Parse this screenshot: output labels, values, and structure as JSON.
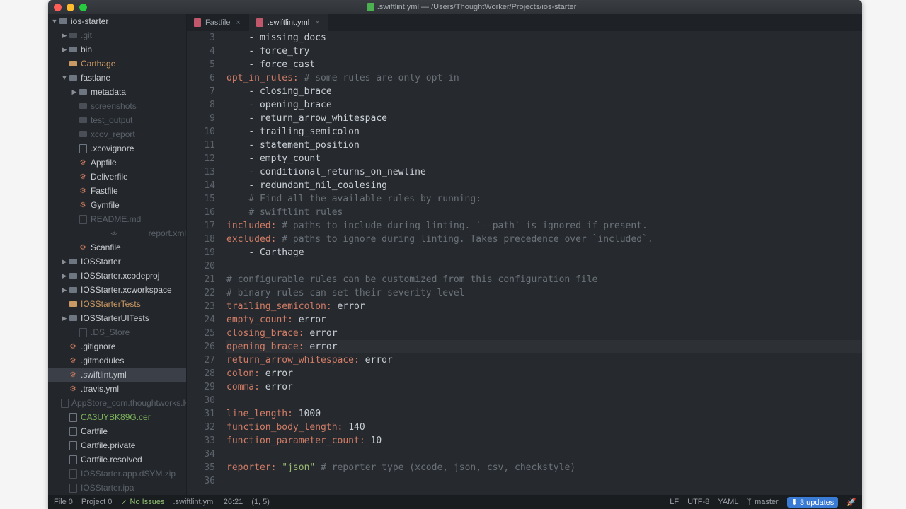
{
  "window": {
    "title": ".swiftlint.yml — /Users/ThoughtWorker/Projects/ios-starter"
  },
  "tree": [
    {
      "depth": 0,
      "chev": "▼",
      "icon": "folder",
      "label": "ios-starter"
    },
    {
      "depth": 1,
      "chev": "▶",
      "icon": "folder dim",
      "label": ".git",
      "cls": "dim"
    },
    {
      "depth": 1,
      "chev": "▶",
      "icon": "folder",
      "label": "bin"
    },
    {
      "depth": 1,
      "chev": "",
      "icon": "folder hl",
      "label": "Carthage",
      "cls": "hl"
    },
    {
      "depth": 1,
      "chev": "▼",
      "icon": "folder",
      "label": "fastlane"
    },
    {
      "depth": 2,
      "chev": "▶",
      "icon": "folder",
      "label": "metadata"
    },
    {
      "depth": 2,
      "chev": "",
      "icon": "folder dim",
      "label": "screenshots",
      "cls": "dim"
    },
    {
      "depth": 2,
      "chev": "",
      "icon": "folder dim",
      "label": "test_output",
      "cls": "dim"
    },
    {
      "depth": 2,
      "chev": "",
      "icon": "folder dim",
      "label": "xcov_report",
      "cls": "dim"
    },
    {
      "depth": 2,
      "chev": "",
      "icon": "file",
      "label": ".xcovignore"
    },
    {
      "depth": 2,
      "chev": "",
      "icon": "gear",
      "label": "Appfile"
    },
    {
      "depth": 2,
      "chev": "",
      "icon": "gear",
      "label": "Deliverfile"
    },
    {
      "depth": 2,
      "chev": "",
      "icon": "gear",
      "label": "Fastfile"
    },
    {
      "depth": 2,
      "chev": "",
      "icon": "gear",
      "label": "Gymfile"
    },
    {
      "depth": 2,
      "chev": "",
      "icon": "file dim",
      "label": "README.md",
      "cls": "dim"
    },
    {
      "depth": 2,
      "chev": "",
      "icon": "code",
      "label": "report.xml",
      "cls": "dim"
    },
    {
      "depth": 2,
      "chev": "",
      "icon": "gear",
      "label": "Scanfile"
    },
    {
      "depth": 1,
      "chev": "▶",
      "icon": "folder",
      "label": "IOSStarter"
    },
    {
      "depth": 1,
      "chev": "▶",
      "icon": "folder",
      "label": "IOSStarter.xcodeproj"
    },
    {
      "depth": 1,
      "chev": "▶",
      "icon": "folder",
      "label": "IOSStarter.xcworkspace"
    },
    {
      "depth": 1,
      "chev": "",
      "icon": "folder hl",
      "label": "IOSStarterTests",
      "cls": "hl"
    },
    {
      "depth": 1,
      "chev": "▶",
      "icon": "folder",
      "label": "IOSStarterUITests"
    },
    {
      "depth": 2,
      "chev": "",
      "icon": "file dim",
      "label": ".DS_Store",
      "cls": "dim"
    },
    {
      "depth": 1,
      "chev": "",
      "icon": "gear",
      "label": ".gitignore"
    },
    {
      "depth": 1,
      "chev": "",
      "icon": "gear",
      "label": ".gitmodules"
    },
    {
      "depth": 1,
      "chev": "",
      "icon": "gear",
      "label": ".swiftlint.yml",
      "selected": true
    },
    {
      "depth": 1,
      "chev": "",
      "icon": "gear",
      "label": ".travis.yml"
    },
    {
      "depth": 1,
      "chev": "",
      "icon": "file dim",
      "label": "AppStore_com.thoughtworks.IOSS",
      "cls": "dim"
    },
    {
      "depth": 1,
      "chev": "",
      "icon": "file",
      "label": "CA3UYBK89G.cer",
      "cls": "green"
    },
    {
      "depth": 1,
      "chev": "",
      "icon": "file",
      "label": "Cartfile"
    },
    {
      "depth": 1,
      "chev": "",
      "icon": "file",
      "label": "Cartfile.private"
    },
    {
      "depth": 1,
      "chev": "",
      "icon": "file",
      "label": "Cartfile.resolved"
    },
    {
      "depth": 1,
      "chev": "",
      "icon": "file dim",
      "label": "IOSStarter.app.dSYM.zip",
      "cls": "dim"
    },
    {
      "depth": 1,
      "chev": "",
      "icon": "file dim",
      "label": "IOSStarter.ipa",
      "cls": "dim"
    }
  ],
  "tabs": [
    {
      "label": "Fastfile",
      "active": false
    },
    {
      "label": ".swiftlint.yml",
      "active": true
    }
  ],
  "code": {
    "start": 3,
    "highlight": 26,
    "lines": [
      [
        [
          "txt",
          "    - missing_docs"
        ]
      ],
      [
        [
          "txt",
          "    - force_try"
        ]
      ],
      [
        [
          "txt",
          "    - force_cast"
        ]
      ],
      [
        [
          "key",
          "opt_in_rules:"
        ],
        [
          "txt",
          " "
        ],
        [
          "cmt",
          "# some rules are only opt-in"
        ]
      ],
      [
        [
          "txt",
          "    - closing_brace"
        ]
      ],
      [
        [
          "txt",
          "    - opening_brace"
        ]
      ],
      [
        [
          "txt",
          "    - return_arrow_whitespace"
        ]
      ],
      [
        [
          "txt",
          "    - trailing_semicolon"
        ]
      ],
      [
        [
          "txt",
          "    - statement_position"
        ]
      ],
      [
        [
          "txt",
          "    - empty_count"
        ]
      ],
      [
        [
          "txt",
          "    - conditional_returns_on_newline"
        ]
      ],
      [
        [
          "txt",
          "    - redundant_nil_coalesing"
        ]
      ],
      [
        [
          "txt",
          "    "
        ],
        [
          "cmt",
          "# Find all the available rules by running:"
        ]
      ],
      [
        [
          "txt",
          "    "
        ],
        [
          "cmt",
          "# swiftlint rules"
        ]
      ],
      [
        [
          "key",
          "included:"
        ],
        [
          "txt",
          " "
        ],
        [
          "cmt",
          "# paths to include during linting. `--path` is ignored if present."
        ]
      ],
      [
        [
          "key",
          "excluded:"
        ],
        [
          "txt",
          " "
        ],
        [
          "cmt",
          "# paths to ignore during linting. Takes precedence over `included`."
        ]
      ],
      [
        [
          "txt",
          "    - Carthage"
        ]
      ],
      [
        [
          "txt",
          ""
        ]
      ],
      [
        [
          "cmt",
          "# configurable rules can be customized from this configuration file"
        ]
      ],
      [
        [
          "cmt",
          "# binary rules can set their severity level"
        ]
      ],
      [
        [
          "key",
          "trailing_semicolon:"
        ],
        [
          "txt",
          " error"
        ]
      ],
      [
        [
          "key",
          "empty_count:"
        ],
        [
          "txt",
          " error"
        ]
      ],
      [
        [
          "key",
          "closing_brace:"
        ],
        [
          "txt",
          " error"
        ]
      ],
      [
        [
          "key",
          "opening_brace:"
        ],
        [
          "txt",
          " error"
        ]
      ],
      [
        [
          "key",
          "return_arrow_whitespace:"
        ],
        [
          "txt",
          " error"
        ]
      ],
      [
        [
          "key",
          "colon:"
        ],
        [
          "txt",
          " error"
        ]
      ],
      [
        [
          "key",
          "comma:"
        ],
        [
          "txt",
          " error"
        ]
      ],
      [
        [
          "txt",
          ""
        ]
      ],
      [
        [
          "key",
          "line_length:"
        ],
        [
          "txt",
          " 1000"
        ]
      ],
      [
        [
          "key",
          "function_body_length:"
        ],
        [
          "txt",
          " 140"
        ]
      ],
      [
        [
          "key",
          "function_parameter_count:"
        ],
        [
          "txt",
          " 10"
        ]
      ],
      [
        [
          "txt",
          ""
        ]
      ],
      [
        [
          "key",
          "reporter:"
        ],
        [
          "txt",
          " "
        ],
        [
          "str",
          "\"json\""
        ],
        [
          "txt",
          " "
        ],
        [
          "cmt",
          "# reporter type (xcode, json, csv, checkstyle)"
        ]
      ],
      [
        [
          "txt",
          ""
        ]
      ]
    ]
  },
  "statusbar": {
    "file": "File 0",
    "project": "Project 0",
    "issues": "No Issues",
    "filename": ".swiftlint.yml",
    "pos": "26:21",
    "sel": "(1, 5)",
    "lf": "LF",
    "enc": "UTF-8",
    "lang": "YAML",
    "branch": "master",
    "updates": "3 updates"
  }
}
